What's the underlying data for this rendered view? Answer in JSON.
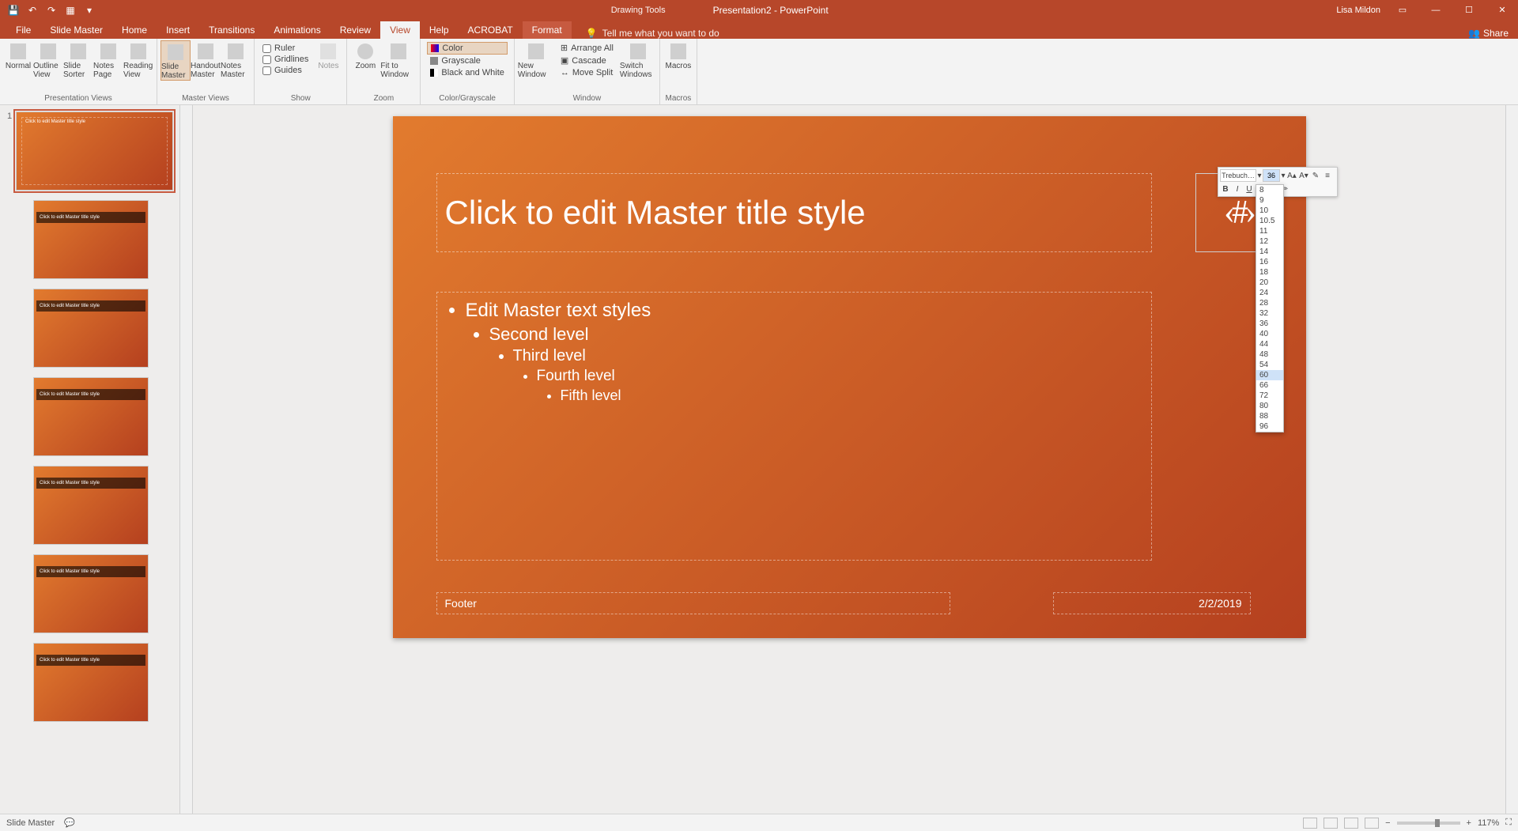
{
  "title_bar": {
    "context_tab": "Drawing Tools",
    "document_name": "Presentation2 - PowerPoint",
    "user": "Lisa Mildon"
  },
  "tabs": [
    "File",
    "Slide Master",
    "Home",
    "Insert",
    "Transitions",
    "Animations",
    "Review",
    "View",
    "Help",
    "ACROBAT",
    "Format"
  ],
  "active_tab": "View",
  "tell_me": "Tell me what you want to do",
  "share": "Share",
  "ribbon": {
    "presentation_views": {
      "label": "Presentation Views",
      "buttons": [
        "Normal",
        "Outline View",
        "Slide Sorter",
        "Notes Page",
        "Reading View"
      ]
    },
    "master_views": {
      "label": "Master Views",
      "buttons": [
        "Slide Master",
        "Handout Master",
        "Notes Master"
      ]
    },
    "show": {
      "label": "Show",
      "checks": [
        "Ruler",
        "Gridlines",
        "Guides"
      ],
      "notes": "Notes"
    },
    "zoom": {
      "label": "Zoom",
      "buttons": [
        "Zoom",
        "Fit to Window"
      ]
    },
    "color": {
      "label": "Color/Grayscale",
      "opts": [
        "Color",
        "Grayscale",
        "Black and White"
      ]
    },
    "window": {
      "label": "Window",
      "new": "New Window",
      "opts": [
        "Arrange All",
        "Cascade",
        "Move Split"
      ],
      "switch": "Switch Windows"
    },
    "macros": {
      "label": "Macros",
      "btn": "Macros"
    }
  },
  "thumbnails": {
    "master_num": "1",
    "master_title": "Click to edit Master title style",
    "layout_titles": [
      "Click to edit Master title style",
      "Click to edit Master title style",
      "Click to edit Master title style",
      "Click to edit Master title style",
      "Click to edit Master title style",
      "Click to edit Master title style"
    ]
  },
  "slide": {
    "title": "Click to edit Master title style",
    "pagenum": "‹#›",
    "body": {
      "l1": "Edit Master text styles",
      "l2": "Second level",
      "l3": "Third level",
      "l4": "Fourth level",
      "l5": "Fifth level"
    },
    "footer": "Footer",
    "date": "2/2/2019"
  },
  "mini_toolbar": {
    "font": "Trebuch…",
    "size": "36"
  },
  "font_sizes": [
    "8",
    "9",
    "10",
    "10.5",
    "11",
    "12",
    "14",
    "16",
    "18",
    "20",
    "24",
    "28",
    "32",
    "36",
    "40",
    "44",
    "48",
    "54",
    "60",
    "66",
    "72",
    "80",
    "88",
    "96"
  ],
  "highlighted_size": "60",
  "status": {
    "mode": "Slide Master",
    "zoom": "117%"
  }
}
